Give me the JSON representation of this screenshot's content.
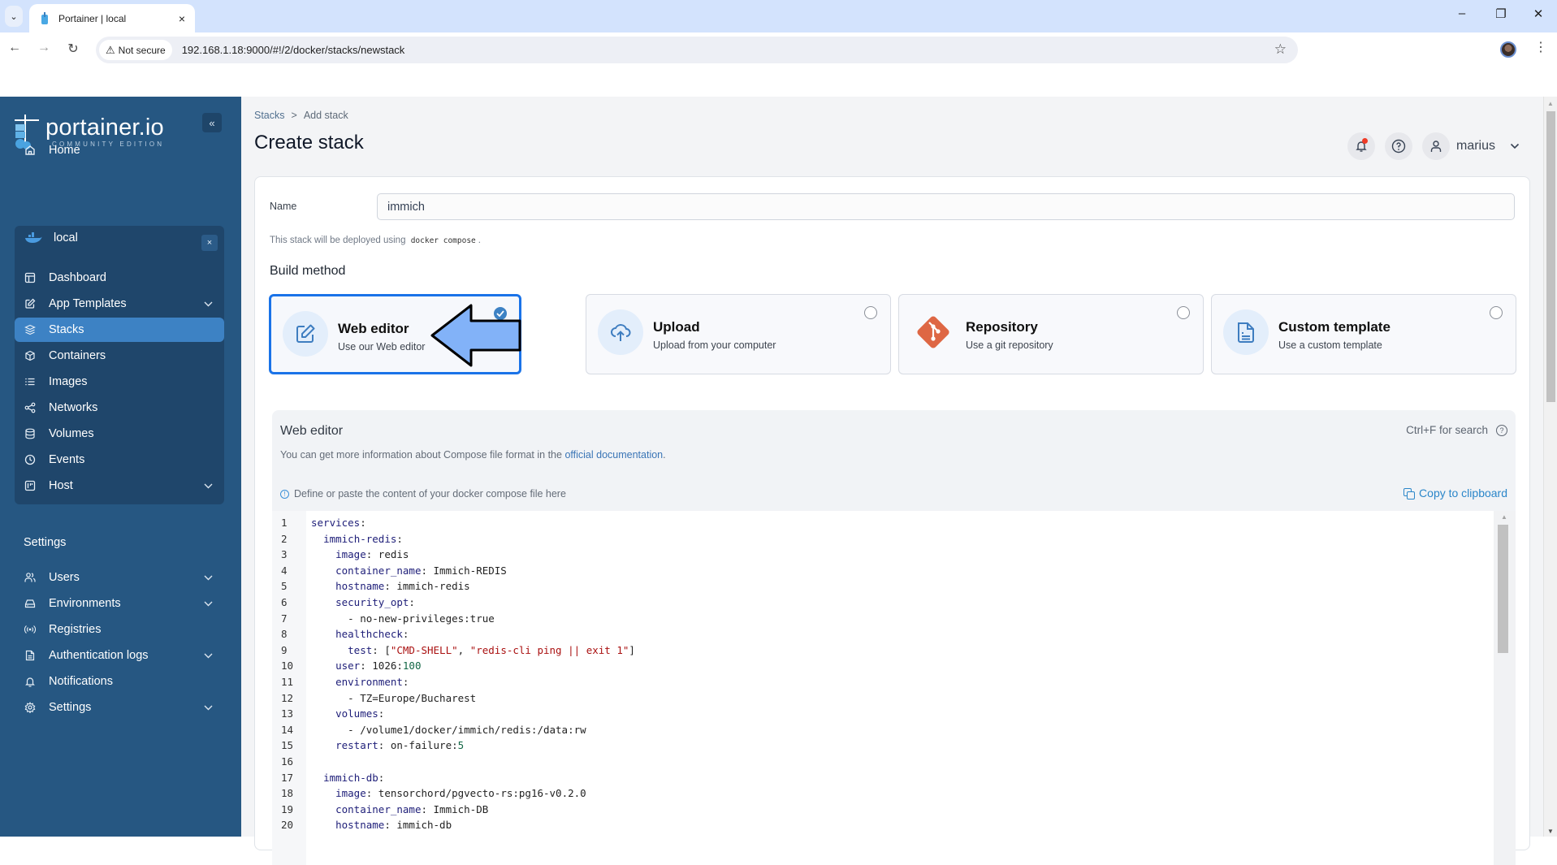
{
  "browser": {
    "tab_title": "Portainer | local",
    "security_label": "Not secure",
    "url": "192.168.1.18:9000/#!/2/docker/stacks/newstack",
    "icons": {
      "tab_list": "chevron-down",
      "tab_close": "×",
      "minimize": "–",
      "restore": "❐",
      "close": "✕",
      "back": "←",
      "forward": "→",
      "reload": "↻",
      "bookmark": "☆",
      "menu": "⋮",
      "warning": "⚠"
    }
  },
  "sidebar": {
    "logo_text": "portainer.io",
    "logo_subtitle": "COMMUNITY EDITION",
    "collapse_glyph": "«",
    "home_label": "Home",
    "environment": {
      "name": "local",
      "close_glyph": "×",
      "items": [
        {
          "label": "Dashboard",
          "icon": "dashboard-icon",
          "expandable": false,
          "active": false
        },
        {
          "label": "App Templates",
          "icon": "edit-icon",
          "expandable": true,
          "active": false
        },
        {
          "label": "Stacks",
          "icon": "layers-icon",
          "expandable": false,
          "active": true
        },
        {
          "label": "Containers",
          "icon": "box-icon",
          "expandable": false,
          "active": false
        },
        {
          "label": "Images",
          "icon": "list-icon",
          "expandable": false,
          "active": false
        },
        {
          "label": "Networks",
          "icon": "share-icon",
          "expandable": false,
          "active": false
        },
        {
          "label": "Volumes",
          "icon": "database-icon",
          "expandable": false,
          "active": false
        },
        {
          "label": "Events",
          "icon": "clock-icon",
          "expandable": false,
          "active": false
        },
        {
          "label": "Host",
          "icon": "host-icon",
          "expandable": true,
          "active": false
        }
      ]
    },
    "settings_section": "Settings",
    "settings_items": [
      {
        "label": "Users",
        "icon": "users-icon",
        "expandable": true
      },
      {
        "label": "Environments",
        "icon": "hard-drive-icon",
        "expandable": true
      },
      {
        "label": "Registries",
        "icon": "radio-icon",
        "expandable": false
      },
      {
        "label": "Authentication logs",
        "icon": "file-text-icon",
        "expandable": true
      },
      {
        "label": "Notifications",
        "icon": "bell-icon",
        "expandable": false
      },
      {
        "label": "Settings",
        "icon": "gear-icon",
        "expandable": true
      }
    ]
  },
  "header": {
    "breadcrumb": {
      "parent": "Stacks",
      "separator": ">",
      "current": "Add stack"
    },
    "title": "Create stack",
    "user": "marius"
  },
  "form": {
    "name_label": "Name",
    "name_value": "immich",
    "deploy_note_prefix": "This stack will be deployed using",
    "deploy_note_code": "docker compose",
    "deploy_note_suffix": ".",
    "build_method_label": "Build method",
    "build_methods": [
      {
        "title": "Web editor",
        "subtitle": "Use our Web editor",
        "selected": true
      },
      {
        "title": "Upload",
        "subtitle": "Upload from your computer",
        "selected": false
      },
      {
        "title": "Repository",
        "subtitle": "Use a git repository",
        "selected": false
      },
      {
        "title": "Custom template",
        "subtitle": "Use a custom template",
        "selected": false
      }
    ]
  },
  "web_editor": {
    "title": "Web editor",
    "search_hint": "Ctrl+F for search",
    "info_prefix": "You can get more information about Compose file format in the",
    "info_link": "official documentation",
    "info_suffix": ".",
    "define_hint": "Define or paste the content of your docker compose file here",
    "copy_label": "Copy to clipboard",
    "lines": [
      {
        "n": "1",
        "indent": "",
        "key": "services",
        "sep": ":",
        "val": ""
      },
      {
        "n": "2",
        "indent": "  ",
        "key": "immich-redis",
        "sep": ":",
        "val": ""
      },
      {
        "n": "3",
        "indent": "    ",
        "key": "image",
        "sep": ": ",
        "val": "redis"
      },
      {
        "n": "4",
        "indent": "    ",
        "key": "container_name",
        "sep": ": ",
        "val": "Immich-REDIS"
      },
      {
        "n": "5",
        "indent": "    ",
        "key": "hostname",
        "sep": ": ",
        "val": "immich-redis"
      },
      {
        "n": "6",
        "indent": "    ",
        "key": "security_opt",
        "sep": ":",
        "val": ""
      },
      {
        "n": "7",
        "indent": "      ",
        "key": "",
        "sep": "",
        "val": "- no-new-privileges:true"
      },
      {
        "n": "8",
        "indent": "    ",
        "key": "healthcheck",
        "sep": ":",
        "val": ""
      },
      {
        "n": "9",
        "indent": "      ",
        "key": "test",
        "sep": ": ",
        "val": "[\"CMD-SHELL\", \"redis-cli ping || exit 1\"]"
      },
      {
        "n": "10",
        "indent": "    ",
        "key": "user",
        "sep": ": ",
        "val": "1026:100"
      },
      {
        "n": "11",
        "indent": "    ",
        "key": "environment",
        "sep": ":",
        "val": ""
      },
      {
        "n": "12",
        "indent": "      ",
        "key": "",
        "sep": "",
        "val": "- TZ=Europe/Bucharest"
      },
      {
        "n": "13",
        "indent": "    ",
        "key": "volumes",
        "sep": ":",
        "val": ""
      },
      {
        "n": "14",
        "indent": "      ",
        "key": "",
        "sep": "",
        "val": "- /volume1/docker/immich/redis:/data:rw"
      },
      {
        "n": "15",
        "indent": "    ",
        "key": "restart",
        "sep": ": ",
        "val": "on-failure:5"
      },
      {
        "n": "16",
        "indent": "",
        "key": "",
        "sep": "",
        "val": ""
      },
      {
        "n": "17",
        "indent": "  ",
        "key": "immich-db",
        "sep": ":",
        "val": ""
      },
      {
        "n": "18",
        "indent": "    ",
        "key": "image",
        "sep": ": ",
        "val": "tensorchord/pgvecto-rs:pg16-v0.2.0"
      },
      {
        "n": "19",
        "indent": "    ",
        "key": "container_name",
        "sep": ": ",
        "val": "Immich-DB"
      },
      {
        "n": "20",
        "indent": "    ",
        "key": "hostname",
        "sep": ": ",
        "val": "immich-db"
      }
    ]
  },
  "colors": {
    "sidebar_bg": "#265782",
    "sidebar_env_bg": "#1f466b",
    "active_item": "#3d82c4",
    "selected_border": "#1a73e8",
    "link": "#3a75b6",
    "git_orange": "#de6744",
    "annotation_arrow": "#82b2f8"
  }
}
